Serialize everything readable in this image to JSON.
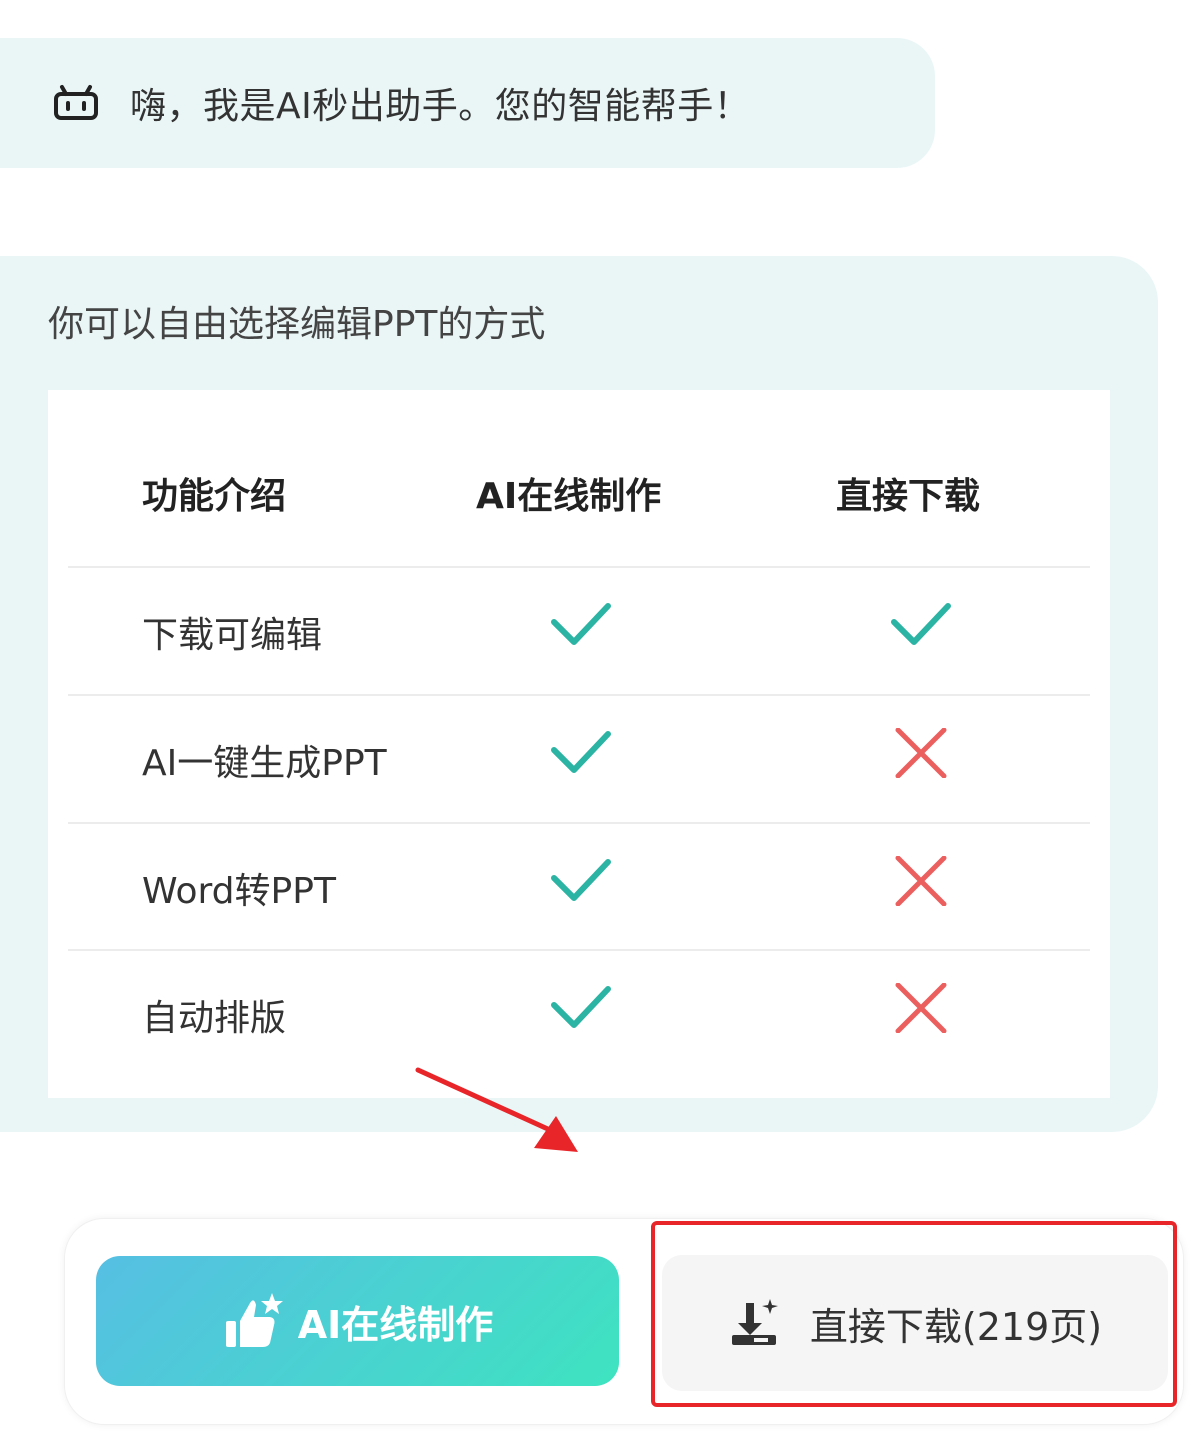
{
  "greeting": {
    "icon": "robot-icon",
    "text": "嗨，我是AI秒出助手。您的智能帮手！"
  },
  "options_card": {
    "title": "你可以自由选择编辑PPT的方式",
    "table": {
      "headers": [
        "功能介绍",
        "AI在线制作",
        "直接下载"
      ],
      "rows": [
        {
          "feature": "下载可编辑",
          "ai_online": "check",
          "direct_download": "check"
        },
        {
          "feature": "AI一键生成PPT",
          "ai_online": "check",
          "direct_download": "cross"
        },
        {
          "feature": "Word转PPT",
          "ai_online": "check",
          "direct_download": "cross"
        },
        {
          "feature": "自动排版",
          "ai_online": "check",
          "direct_download": "cross"
        }
      ]
    }
  },
  "actions": {
    "ai_online_label": "AI在线制作",
    "ai_online_icon": "thumbs-up-star-icon",
    "download_label": "直接下载(219页)",
    "download_icon": "download-sparkle-icon"
  },
  "colors": {
    "check": "#2bb3a3",
    "cross": "#ec5f5f",
    "highlight": "#e8262a",
    "card_bg": "#eaf6f6"
  }
}
